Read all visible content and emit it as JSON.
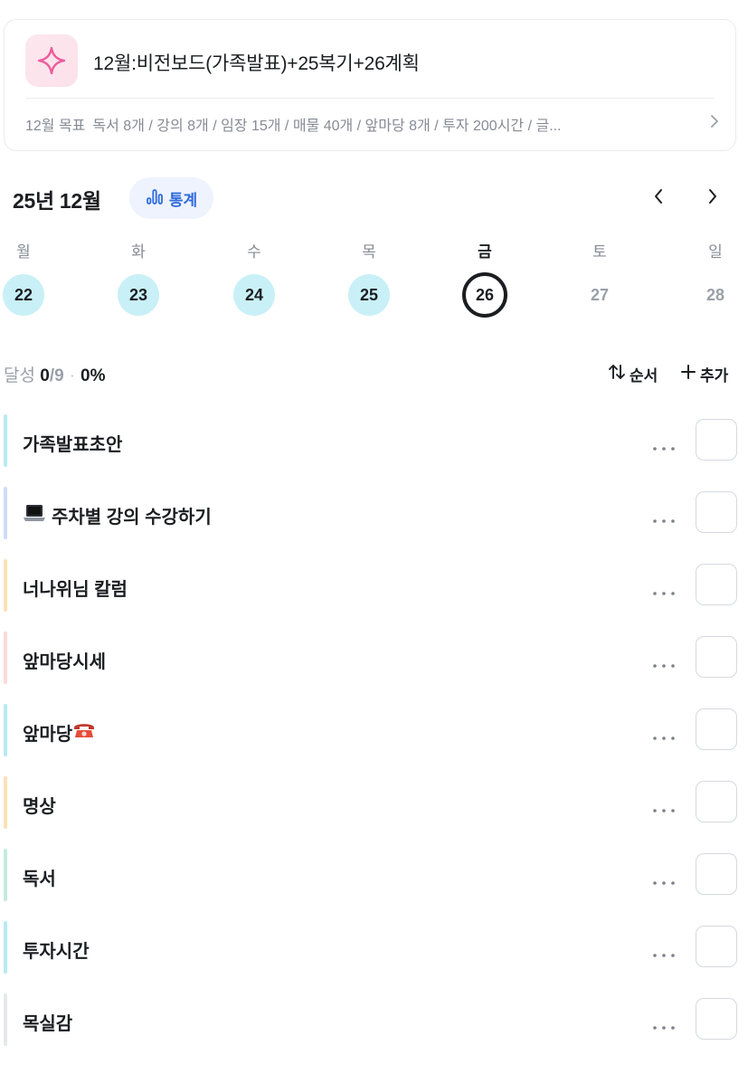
{
  "goal": {
    "title": "12월:비전보드(가족발표)+25복기+26계획",
    "subtitle_label": "12월 목표",
    "subtitle_text": "독서 8개 / 강의 8개 / 임장 15개 / 매물 40개 / 앞마당 8개 / 투자 200시간 / 글...",
    "icon": "sparkle-icon"
  },
  "calendar": {
    "month_title": "25년 12월",
    "stats_label": "통계",
    "weekdays": [
      "월",
      "화",
      "수",
      "목",
      "금",
      "토",
      "일"
    ],
    "days": [
      "22",
      "23",
      "24",
      "25",
      "26",
      "27",
      "28"
    ],
    "day_states": [
      "done",
      "done",
      "done",
      "done",
      "today",
      "future",
      "future"
    ]
  },
  "progress": {
    "label": "달성",
    "count": "0",
    "total": "/9",
    "separator": "·",
    "percent": "0%"
  },
  "actions": {
    "sort_label": "순서",
    "add_label": "추가"
  },
  "tasks": [
    {
      "label": "가족발표초안",
      "emoji": "",
      "color": "#b8eaf2"
    },
    {
      "label": "주차별 강의 수강하기",
      "emoji": "💻",
      "color": "#cfdcf8"
    },
    {
      "label": "너나위님 칼럼",
      "emoji": "",
      "color": "#fde0b8"
    },
    {
      "label": "앞마당시세",
      "emoji": "",
      "color": "#fbdada"
    },
    {
      "label": "앞마당",
      "emoji": "☎️",
      "color": "#b8eaf2"
    },
    {
      "label": "명상",
      "emoji": "",
      "color": "#fde0b8"
    },
    {
      "label": "독서",
      "emoji": "",
      "color": "#c2ecdd"
    },
    {
      "label": "투자시간",
      "emoji": "",
      "color": "#b8eaf2"
    },
    {
      "label": "목실감",
      "emoji": "",
      "color": "#e6e8eb"
    }
  ],
  "colors": {
    "done_day": "#c9f0f7",
    "stats_accent": "#2f6bdc",
    "text_primary": "#1b1d21",
    "text_muted": "#868b94"
  }
}
